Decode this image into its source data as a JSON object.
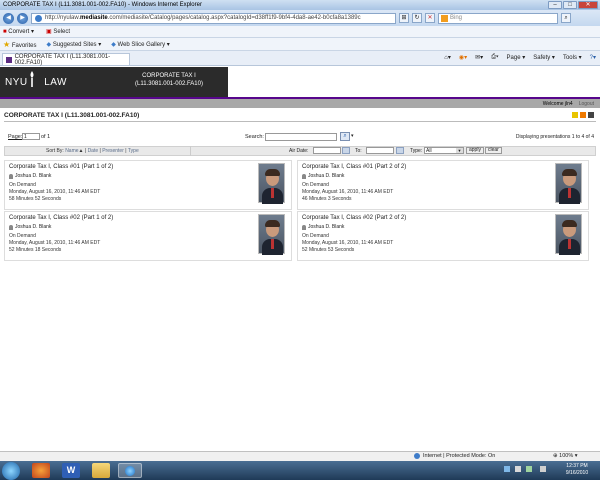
{
  "window": {
    "title": "CORPORATE TAX I (L11.3081.001-002.FA10) - Windows Internet Explorer",
    "min": "–",
    "max": "□",
    "close": "✕"
  },
  "address": {
    "url_host": "http://nyulaw.",
    "url_bold": "mediasite",
    "url_rest": ".com/mediasite/Catalog/pages/catalog.aspx?catalogId=d38ff1f9-9bf4-4da8-ae42-b0cfa8a1389c",
    "search_placeholder": "Bing"
  },
  "command_bar": {
    "convert": "Convert",
    "select": "Select"
  },
  "favorites_bar": {
    "favorites": "Favorites",
    "suggested": "Suggested Sites",
    "webslice": "Web Slice Gallery"
  },
  "tab": {
    "label": "CORPORATE TAX I (L11.3081.001-002.FA10)"
  },
  "ie_tools": {
    "page": "Page",
    "safety": "Safety",
    "tools": "Tools"
  },
  "header": {
    "logo_left": "NYU",
    "logo_right": "LAW",
    "title_line1": "CORPORATE TAX I",
    "title_line2": "(L11.3081.001-002.FA10)"
  },
  "user": {
    "welcome": "Welcome jln4",
    "logout": "Logout"
  },
  "course_title": "CORPORATE TAX I (L11.3081.001-002.FA10)",
  "pager": {
    "label": "Page:",
    "value": "1",
    "of": "of 1"
  },
  "search": {
    "label": "Search:",
    "value": "",
    "dropdown": "▾"
  },
  "displaying": "Displaying presentations 1 to 4 of 4",
  "sort": {
    "label": "Sort By:",
    "name": "Name",
    "date": "Date",
    "presenter": "Presenter",
    "type": "Type"
  },
  "filter": {
    "air_date": "Air Date:",
    "to": "To:",
    "type": "Type:",
    "type_value": "All",
    "apply": "apply",
    "clear": "clear"
  },
  "presentations": [
    {
      "title": "Corporate Tax I, Class #01 (Part 1 of 2)",
      "presenter": "Joshua D. Blank",
      "mode": "On Demand",
      "date": "Monday, August 16, 2010, 11:46 AM EDT",
      "duration": "58 Minutes 52 Seconds"
    },
    {
      "title": "Corporate Tax I, Class #01 (Part 2 of 2)",
      "presenter": "Joshua D. Blank",
      "mode": "On Demand",
      "date": "Monday, August 16, 2010, 11:46 AM EDT",
      "duration": "46 Minutes 3 Seconds"
    },
    {
      "title": "Corporate Tax I, Class #02 (Part 1 of 2)",
      "presenter": "Joshua D. Blank",
      "mode": "On Demand",
      "date": "Monday, August 16, 2010, 11:46 AM EDT",
      "duration": "52 Minutes 18 Seconds"
    },
    {
      "title": "Corporate Tax I, Class #02 (Part 2 of 2)",
      "presenter": "Joshua D. Blank",
      "mode": "On Demand",
      "date": "Monday, August 16, 2010, 11:46 AM EDT",
      "duration": "52 Minutes 53 Seconds"
    }
  ],
  "status_bar": {
    "zone": "Internet | Protected Mode: On",
    "zoom": "100%"
  },
  "clock": {
    "time": "12:37 PM",
    "date": "9/16/2010"
  },
  "taskbar_icons": [
    "start-orb-icon",
    "firefox-icon",
    "word-icon",
    "explorer-folder-icon",
    "internet-explorer-icon"
  ],
  "colors": {
    "nyu_purple": "#57068c",
    "header_dark": "#2b2b2b",
    "user_bar": "#a8a8a8"
  }
}
